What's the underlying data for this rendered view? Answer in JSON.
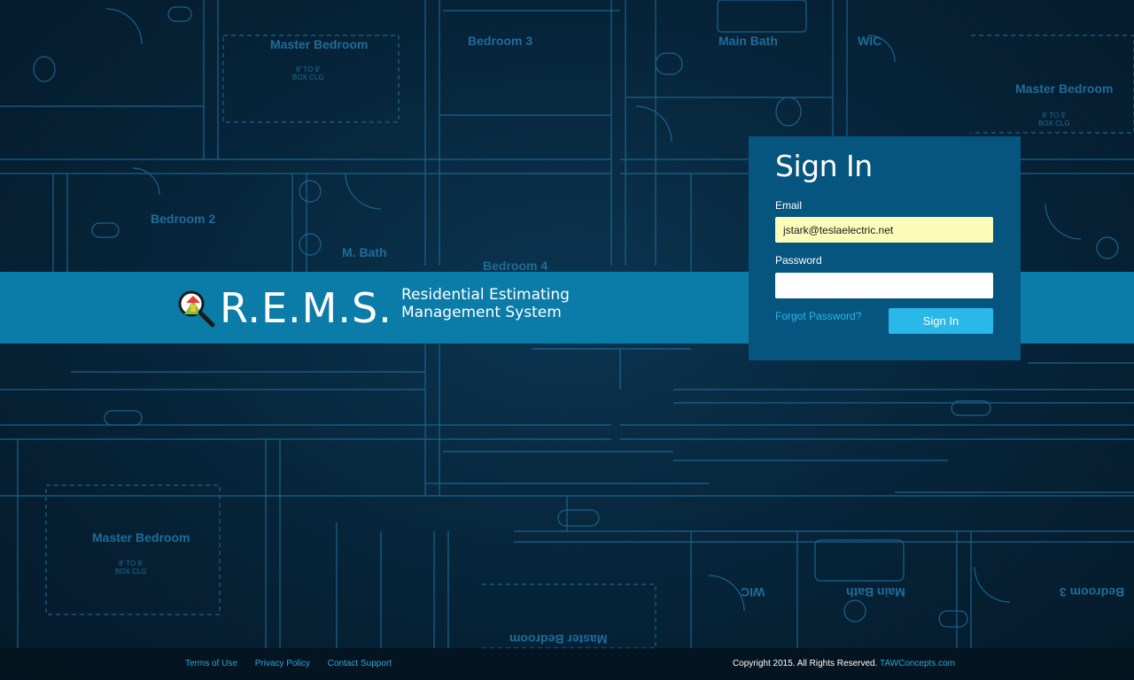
{
  "background": {
    "rooms": [
      {
        "name": "Master Bedroom",
        "note": "8' TO 9'\nBOX CLG"
      },
      {
        "name": "Bedroom 3"
      },
      {
        "name": "Main Bath"
      },
      {
        "name": "WIC"
      },
      {
        "name": "Master Bedroom",
        "note": "8' TO 9'\nBOX CLG"
      },
      {
        "name": "Bedroom 2"
      },
      {
        "name": "M. Bath"
      },
      {
        "name": "Bedroom 4"
      },
      {
        "name": "Master Bedroom",
        "note": "8' TO 9'\nBOX CLG"
      },
      {
        "name": "WIC"
      },
      {
        "name": "Main Bath"
      },
      {
        "name": "Master Bedroom"
      },
      {
        "name": "Bedroom 3"
      }
    ]
  },
  "brand": {
    "name": "R.E.M.S.",
    "subtitle_line1": "Residential Estimating",
    "subtitle_line2": "Management System",
    "logo_icon": "magnifier-house-icon"
  },
  "signin": {
    "title": "Sign In",
    "email_label": "Email",
    "email_value": "jstark@teslaelectric.net",
    "password_label": "Password",
    "password_value": "",
    "forgot_label": "Forgot Password?",
    "button_label": "Sign In"
  },
  "footer": {
    "terms": "Terms of Use",
    "privacy": "Privacy Policy",
    "support": "Contact Support",
    "copyright": "Copyright 2015. All Rights Reserved.",
    "company_link": "TAWConcepts.com"
  },
  "colors": {
    "band": "#0b7ca8",
    "panel": "#06557f",
    "button": "#29b8e8",
    "link": "#2aa8dc",
    "email_autofill": "#fbfcb9"
  }
}
